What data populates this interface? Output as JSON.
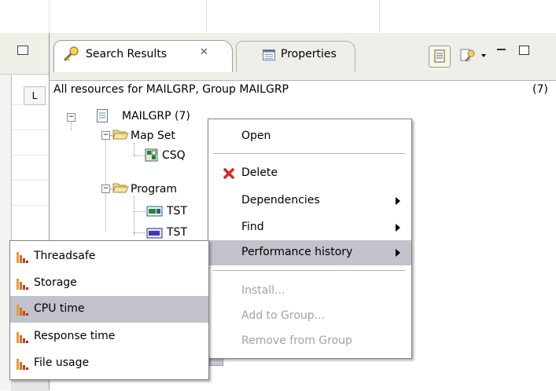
{
  "view": {
    "tabs": [
      {
        "label": "Search Results",
        "active": true,
        "close_symbol": "✕"
      },
      {
        "label": "Properties",
        "active": false
      }
    ],
    "header_text": "All resources for MAILGRP, Group MAILGRP",
    "header_count": "(7)"
  },
  "left_pane": {
    "column_header": "L"
  },
  "tree": {
    "root": {
      "label": "MAILGRP (7)"
    },
    "nodes": [
      {
        "label": "Map Set"
      },
      {
        "label": "CSQ"
      },
      {
        "label": "Program"
      },
      {
        "label": "TST"
      },
      {
        "label": "TST"
      }
    ]
  },
  "context_menu": {
    "items": [
      {
        "label": "Open",
        "enabled": true
      },
      {
        "label": "Delete",
        "enabled": true,
        "icon": "red-x-icon"
      },
      {
        "label": "Dependencies",
        "enabled": true,
        "submenu": true
      },
      {
        "label": "Find",
        "enabled": true,
        "submenu": true
      },
      {
        "label": "Performance history",
        "enabled": true,
        "submenu": true,
        "highlighted": true
      },
      {
        "label": "Install...",
        "enabled": false
      },
      {
        "label": "Add to Group...",
        "enabled": false
      },
      {
        "label": "Remove from Group",
        "enabled": false
      }
    ]
  },
  "submenu": {
    "items": [
      {
        "label": "Threadsafe"
      },
      {
        "label": "Storage"
      },
      {
        "label": "CPU time",
        "highlighted": true
      },
      {
        "label": "Response time"
      },
      {
        "label": "File usage"
      }
    ]
  },
  "colors": {
    "highlight": "#c2c2cc",
    "disabled_text": "#a3a3a3",
    "delete_icon": "#d9261c"
  }
}
